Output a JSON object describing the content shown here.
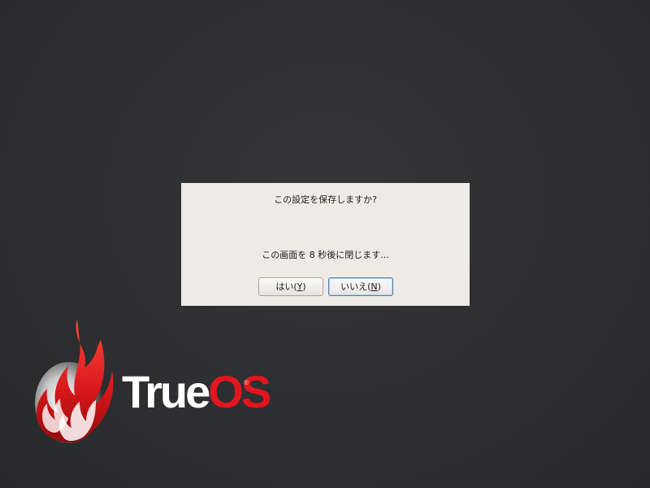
{
  "dialog": {
    "question": "この設定を保存しますか?",
    "countdown": "この画面を 8 秒後に閉じます...",
    "yes_label": "はい(",
    "yes_mnemonic": "Y",
    "yes_suffix": ")",
    "no_label": "いいえ(",
    "no_mnemonic": "N",
    "no_suffix": ")"
  },
  "branding": {
    "name_part1": "True",
    "name_part2": "OS",
    "registered": "®"
  },
  "colors": {
    "background": "#2e2f31",
    "dialog": "#eeebe7",
    "brand_red": "#e2161f"
  }
}
